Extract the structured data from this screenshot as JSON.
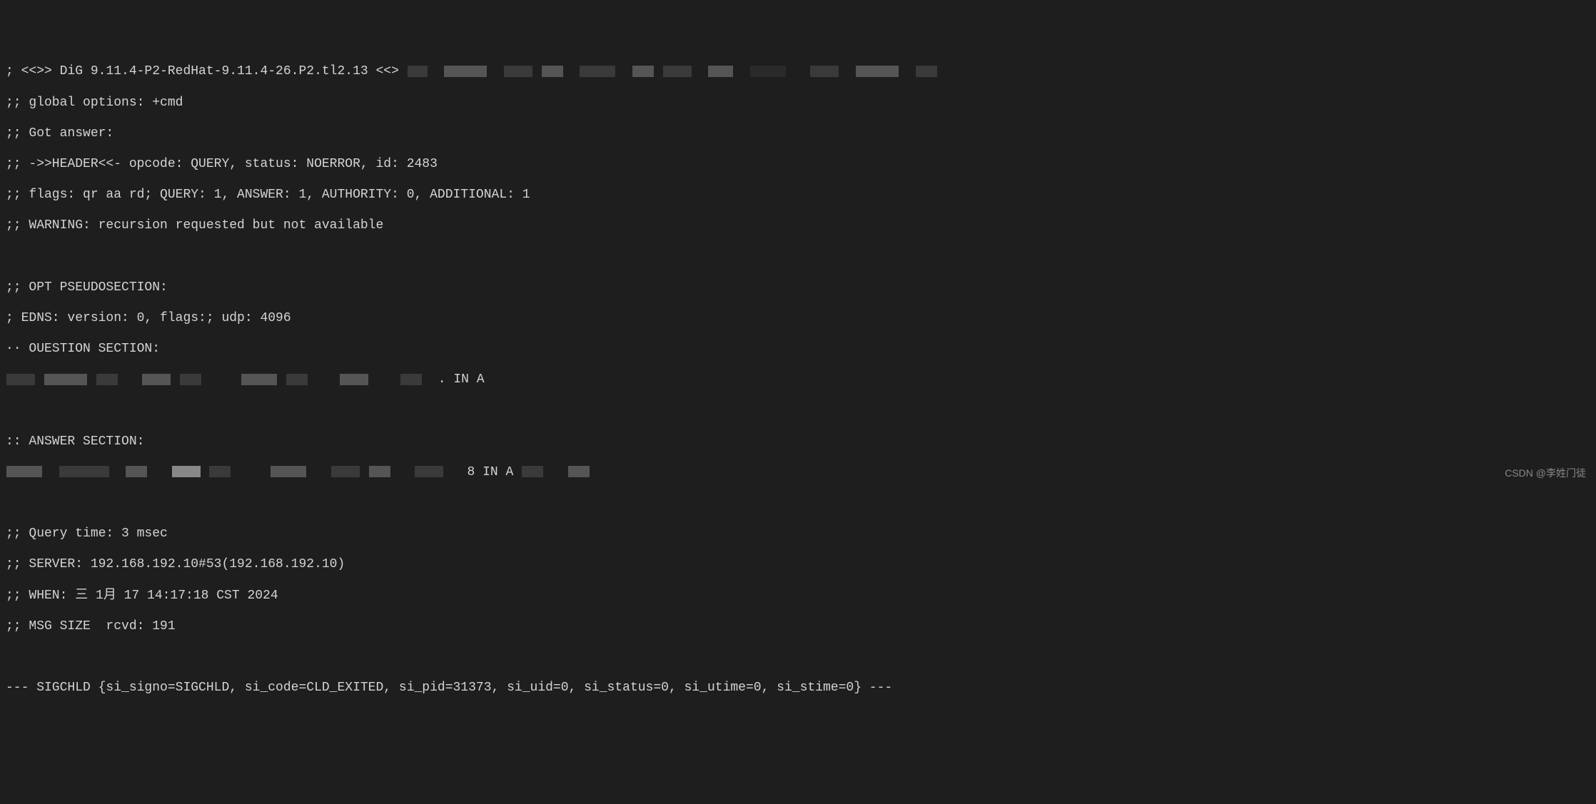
{
  "lines": {
    "l0a": "; <<>> DiG 9.11.4-P2-RedHat-9.11.4-26.P2.tl2.13 <<>",
    "l1": ";; global options: +cmd",
    "l2": ";; Got answer:",
    "l3": ";; ->>HEADER<<- opcode: QUERY, status: NOERROR, id: 2483",
    "l4": ";; flags: qr aa rd; QUERY: 1, ANSWER: 1, AUTHORITY: 0, ADDITIONAL: 1",
    "l5": ";; WARNING: recursion requested but not available",
    "l6": "",
    "l7": ";; OPT PSEUDOSECTION:",
    "l8": "; EDNS: version: 0, flags:; udp: 4096",
    "l9": "·· OUESTION SECTION:",
    "l10a": "",
    "l10b": ". IN A",
    "l11": "",
    "l12": ":: ANSWER SECTION:",
    "l13a": "",
    "l13b": "8 IN A",
    "l14": "",
    "l15": ";; Query time: 3 msec",
    "l16": ";; SERVER: 192.168.192.10#53(192.168.192.10)",
    "l17": ";; WHEN: 三 1月 17 14:17:18 CST 2024",
    "l18": ";; MSG SIZE  rcvd: 191",
    "l19": "",
    "l20": "--- SIGCHLD {si_signo=SIGCHLD, si_code=CLD_EXITED, si_pid=31373, si_uid=0, si_status=0, si_utime=0, si_stime=0} ---"
  },
  "watermark": "CSDN @李姓门徒"
}
